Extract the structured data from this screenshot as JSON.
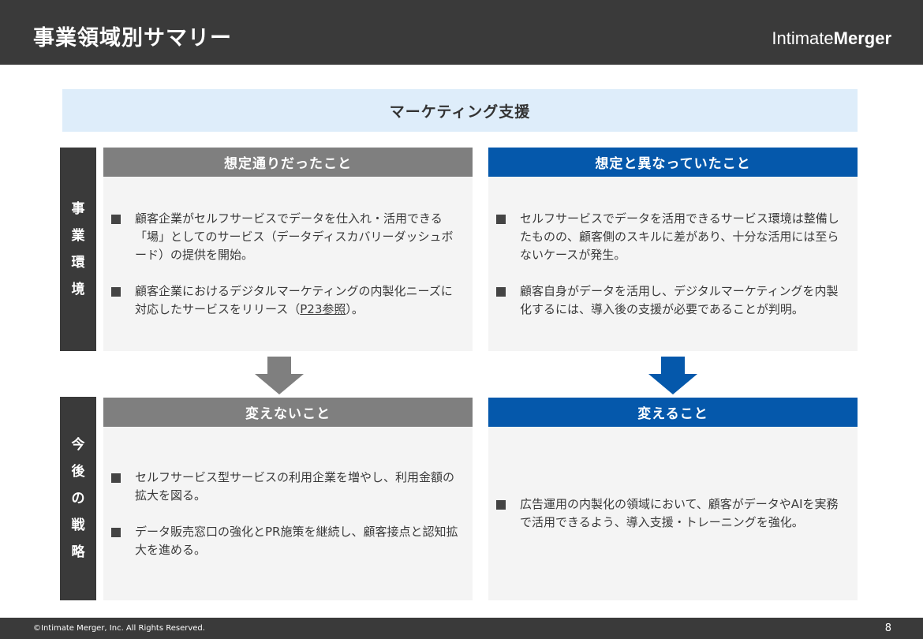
{
  "header": {
    "title": "事業領域別サマリー",
    "logo_light": "Intimate",
    "logo_bold": "Merger"
  },
  "banner": "マーケティング支援",
  "side_labels": {
    "business_environment": [
      "事",
      "業",
      "環",
      "境"
    ],
    "future_strategy": [
      "今",
      "後",
      "の",
      "戦",
      "略"
    ]
  },
  "columns": {
    "expected": "想定通りだったこと",
    "unexpected": "想定と異なっていたこと",
    "unchanged": "変えないこと",
    "changing": "変えること"
  },
  "panels": {
    "expected": [
      "顧客企業がセルフサービスでデータを仕入れ・活用できる「場」としてのサービス（データディスカバリーダッシュボード）の提供を開始。",
      "顧客企業におけるデジタルマーケティングの内製化ニーズに対応したサービスをリリース（P23参照）。"
    ],
    "unexpected": [
      "セルフサービスでデータを活用できるサービス環境は整備したものの、顧客側のスキルに差があり、十分な活用には至らないケースが発生。",
      "顧客自身がデータを活用し、デジタルマーケティングを内製化するには、導入後の支援が必要であることが判明。"
    ],
    "unchanged": [
      "セルフサービス型サービスの利用企業を増やし、利用金額の拡大を図る。",
      "データ販売窓口の強化とPR施策を継続し、顧客接点と認知拡大を進める。"
    ],
    "changing": [
      "広告運用の内製化の領域において、顧客がデータやAIを実務で活用できるよう、導入支援・トレーニングを強化。"
    ]
  },
  "expected_bullet2_parts": {
    "before": "顧客企業におけるデジタルマーケティングの内製化ニーズに対応したサービスをリリース（",
    "link": "P23参照",
    "after": "）。"
  },
  "footer": {
    "copyright": "©Intimate Merger, Inc. All Rights Reserved.",
    "page_number": "8"
  },
  "colors": {
    "dark": "#3a3a3a",
    "gray_header": "#7f7f7f",
    "blue_header": "#0558ab",
    "banner_bg": "#deedfa",
    "panel_bg": "#f4f4f4"
  }
}
